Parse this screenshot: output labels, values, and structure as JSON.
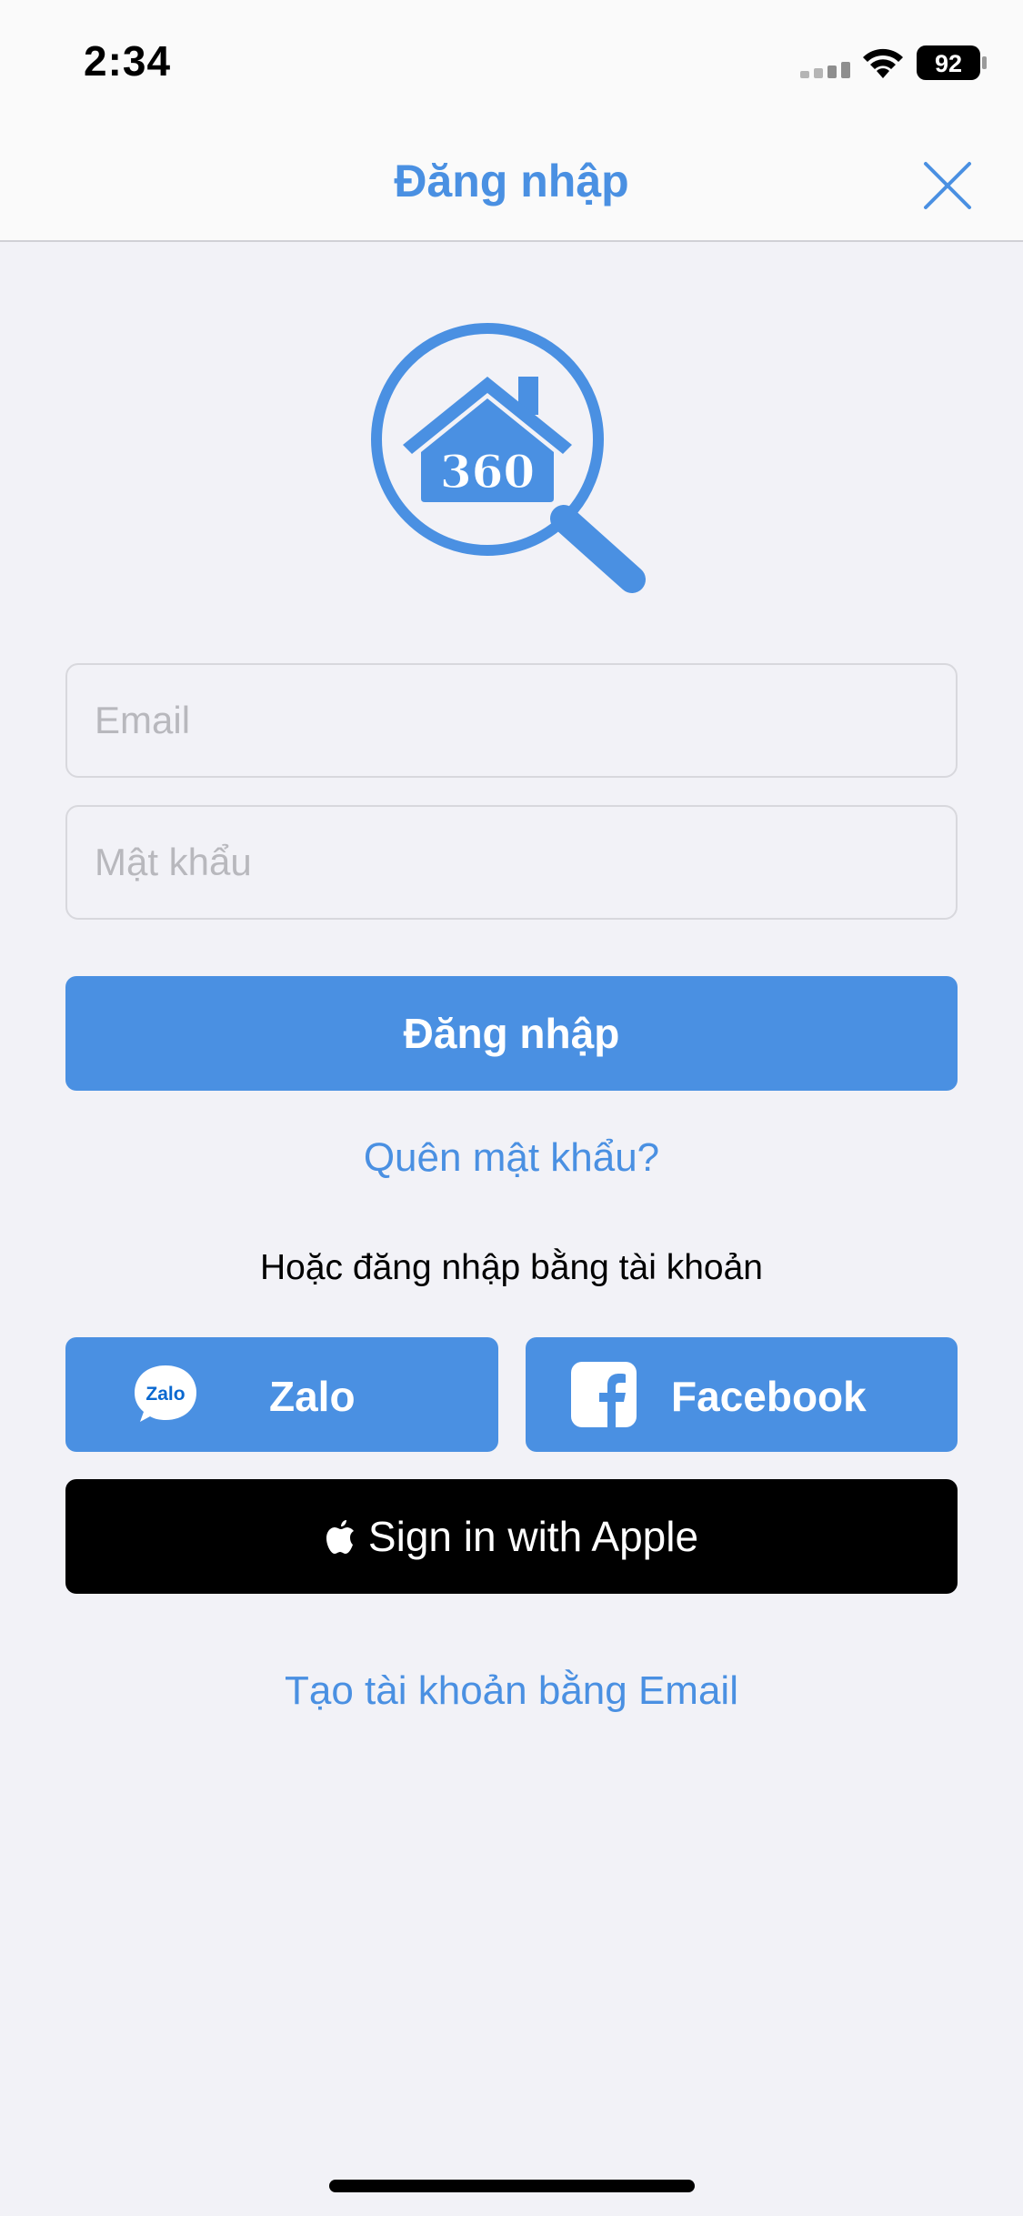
{
  "status_bar": {
    "time": "2:34",
    "battery": "92"
  },
  "header": {
    "title": "Đăng nhập"
  },
  "logo": {
    "text": "360"
  },
  "form": {
    "email_placeholder": "Email",
    "email_value": "",
    "password_placeholder": "Mật khẩu",
    "password_value": "",
    "login_label": "Đăng nhập",
    "forgot_label": "Quên mật khẩu?"
  },
  "social": {
    "or_text": "Hoặc đăng nhập bằng tài khoản",
    "zalo_label": "Zalo",
    "zalo_icon_text": "Zalo",
    "facebook_label": "Facebook",
    "apple_label": "Sign in with Apple"
  },
  "footer": {
    "create_account_label": "Tạo tài khoản bằng Email"
  },
  "colors": {
    "accent": "#4a90e2",
    "background": "#f2f2f7",
    "apple_button": "#000000"
  }
}
